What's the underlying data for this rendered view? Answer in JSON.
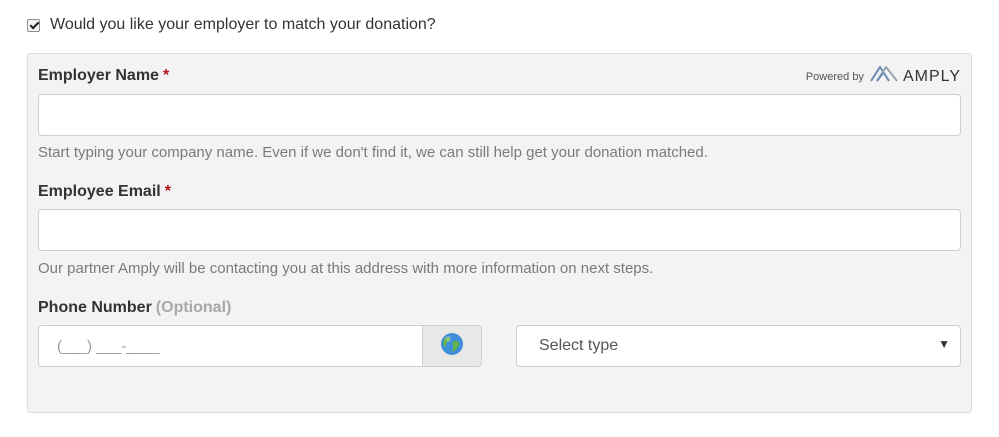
{
  "match": {
    "checked": true,
    "label": "Would you like your employer to match your donation?"
  },
  "powered": {
    "prefix": "Powered by",
    "brand": "AMPLY",
    "logo_icon": "amply-logo-icon"
  },
  "employer": {
    "label": "Employer Name",
    "required_mark": "*",
    "value": "",
    "help": "Start typing your company name. Even if we don't find it, we can still help get your donation matched."
  },
  "email": {
    "label": "Employee Email",
    "required_mark": "*",
    "value": "",
    "help": "Our partner Amply will be contacting you at this address with more information on next steps."
  },
  "phone": {
    "label": "Phone Number",
    "optional": "(Optional)",
    "mask": "(___) ___-____",
    "country_icon": "globe-icon",
    "type_value": "Select type",
    "caret_icon": "caret-down-icon"
  },
  "colors": {
    "required": "#b9121b",
    "panel_bg": "#f3f3f3",
    "help_text": "#7a7a7a"
  }
}
